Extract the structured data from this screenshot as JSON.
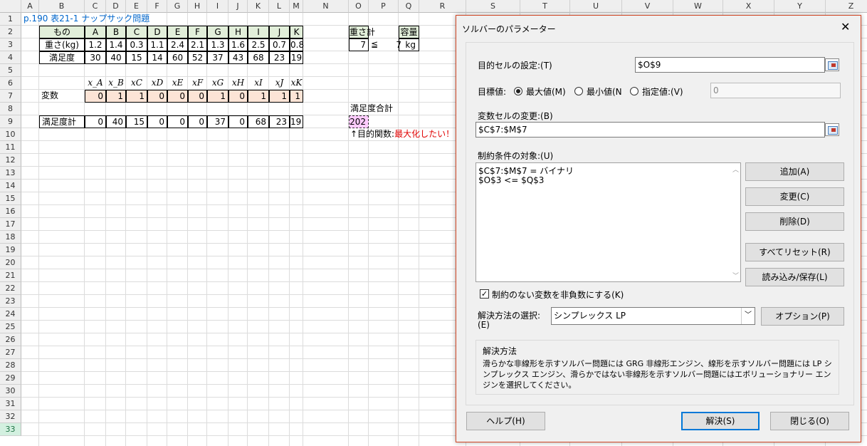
{
  "columns": [
    "A",
    "B",
    "C",
    "D",
    "E",
    "F",
    "G",
    "H",
    "I",
    "J",
    "K",
    "L",
    "M",
    "N",
    "O",
    "P",
    "Q",
    "R",
    "S",
    "T",
    "U",
    "V",
    "W",
    "X",
    "Y",
    "Z"
  ],
  "rows": [
    "1",
    "2",
    "3",
    "4",
    "5",
    "6",
    "7",
    "8",
    "9",
    "10",
    "11",
    "12",
    "13",
    "14",
    "15",
    "16",
    "17",
    "18",
    "19",
    "20",
    "21",
    "22",
    "23",
    "24",
    "25",
    "26",
    "27",
    "28",
    "29",
    "30",
    "31",
    "32",
    "33"
  ],
  "sheet": {
    "title": "p.190 表21-1 ナップサック問題",
    "item_header": "もの",
    "items": [
      "A",
      "B",
      "C",
      "D",
      "E",
      "F",
      "G",
      "H",
      "I",
      "J",
      "K"
    ],
    "weight_label": "重さ(kg)",
    "weights": [
      "1.2",
      "1.4",
      "0.3",
      "1.1",
      "2.4",
      "2.1",
      "1.3",
      "1.6",
      "2.5",
      "0.7",
      "0.8"
    ],
    "satisfaction_label": "満足度",
    "satisfactions": [
      "30",
      "40",
      "15",
      "14",
      "60",
      "52",
      "37",
      "43",
      "68",
      "23",
      "19"
    ],
    "var_headers": [
      "x_A",
      "x_B",
      "xC",
      "xD",
      "xE",
      "xF",
      "xG",
      "xH",
      "xI",
      "xJ",
      "xK"
    ],
    "var_label": "変数",
    "vars": [
      "0",
      "1",
      "1",
      "0",
      "0",
      "0",
      "1",
      "0",
      "1",
      "1",
      "1"
    ],
    "total_label": "満足度計",
    "totals": [
      "0",
      "40",
      "15",
      "0",
      "0",
      "0",
      "37",
      "0",
      "68",
      "23",
      "19"
    ],
    "weight_sum_label": "重さ計",
    "weight_sum": "7",
    "leq": "≦",
    "capacity_label": "容量",
    "capacity": "7",
    "capacity_unit": "kg",
    "sat_total_label": "満足度合計",
    "sat_total": "202",
    "objective_prefix": "↑目的関数:",
    "objective_note": "最大化したい！"
  },
  "dialog": {
    "title": "ソルバーのパラメーター",
    "close_glyph": "✕",
    "objective_label": "目的セルの設定:(T)",
    "objective_value": "$O$9",
    "target_label": "目標値:",
    "opt_max": "最大値(M)",
    "opt_min": "最小値(N",
    "opt_value": "指定値:(V)",
    "value_box": "0",
    "changing_label": "変数セルの変更:(B)",
    "changing_value": "$C$7:$M$7",
    "constraints_label": "制約条件の対象:(U)",
    "constraints": [
      "$C$7:$M$7 = バイナリ",
      "$O$3 <= $Q$3"
    ],
    "btn_add": "追加(A)",
    "btn_change": "変更(C)",
    "btn_delete": "削除(D)",
    "btn_reset": "すべてリセット(R)",
    "btn_load": "読み込み/保存(L)",
    "nonneg_label": "制約のない変数を非負数にする(K)",
    "method_label": "解決方法の選択:",
    "method_label2": "(E)",
    "method_value": "シンプレックス LP",
    "btn_options": "オプション(P)",
    "group_title": "解決方法",
    "group_text": "滑らかな非線形を示すソルバー問題には GRG 非線形エンジン、線形を示すソルバー問題には LP シンプレックス エンジン、滑らかではない非線形を示すソルバー問題にはエボリューショナリー エンジンを選択してください。",
    "btn_help": "ヘルプ(H)",
    "btn_solve": "解決(S)",
    "btn_close": "閉じる(O)"
  }
}
